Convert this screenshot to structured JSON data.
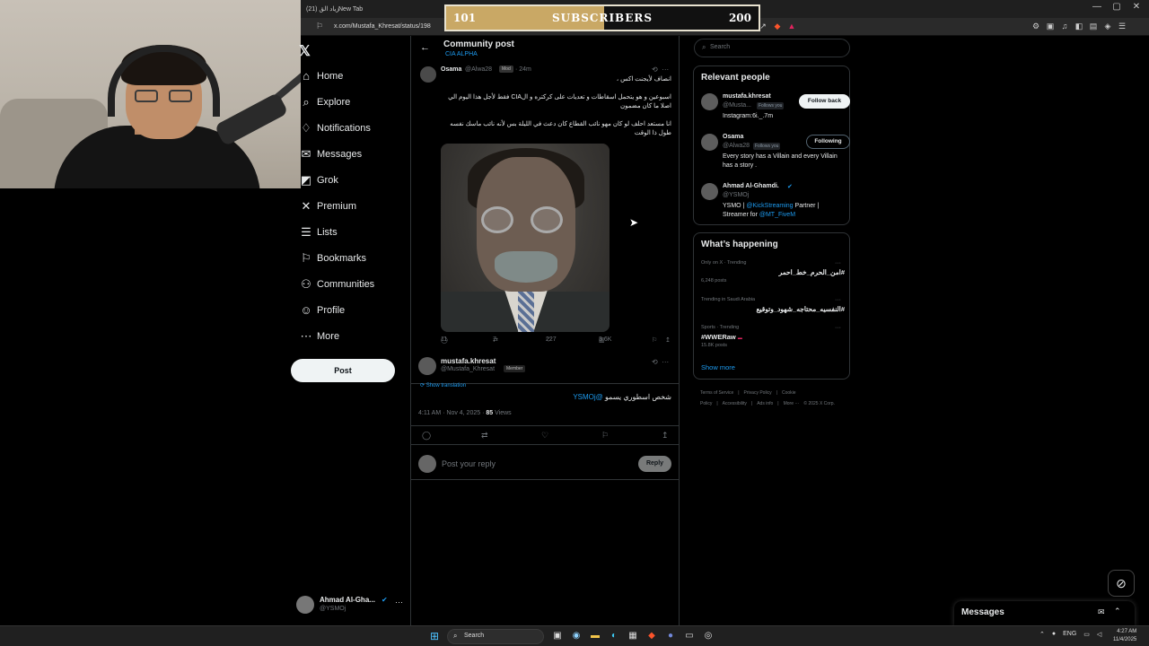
{
  "browser": {
    "tabs": [
      "(21) زياد الق",
      "New Tab"
    ],
    "url": "x.com/Mustafa_Khresat/status/198",
    "window_controls": [
      "—",
      "▢",
      "✕"
    ]
  },
  "subscriber_goal": {
    "current": "101",
    "label": "SUBSCRIBERS",
    "goal": "200",
    "progress_fraction": 0.505,
    "fill_color": "#c9a865"
  },
  "nav": {
    "logo": "𝕏",
    "items": [
      {
        "label": "Home",
        "icon": "home-icon",
        "glyph": "⌂"
      },
      {
        "label": "Explore",
        "icon": "search-icon",
        "glyph": "⌕"
      },
      {
        "label": "Notifications",
        "icon": "bell-icon",
        "glyph": "♢"
      },
      {
        "label": "Messages",
        "icon": "mail-icon",
        "glyph": "✉"
      },
      {
        "label": "Grok",
        "icon": "grok-icon",
        "glyph": "◩"
      },
      {
        "label": "Premium",
        "icon": "x-icon",
        "glyph": "✕"
      },
      {
        "label": "Lists",
        "icon": "list-icon",
        "glyph": "☰"
      },
      {
        "label": "Bookmarks",
        "icon": "bookmark-icon",
        "glyph": "⚐"
      },
      {
        "label": "Communities",
        "icon": "people-icon",
        "glyph": "⚇"
      },
      {
        "label": "Profile",
        "icon": "person-icon",
        "glyph": "☺"
      },
      {
        "label": "More",
        "icon": "more-circle-icon",
        "glyph": "⋯"
      }
    ],
    "post_button": "Post",
    "account": {
      "name": "Ahmad Al-Gha...",
      "handle": "@YSMOj"
    }
  },
  "main": {
    "title": "Community post",
    "community": "CIA ALPHA",
    "post1": {
      "name": "Osama",
      "handle": "@Alwa28",
      "badge": "Mod",
      "time": "· 24m",
      "lines": [
        "انصاف لأيجنت اكس ،",
        "اسبوعين و هو يتحمل اسقاطات و تعديات على كركتره و الCIA فقط لأجل هذا اليوم الي",
        "اصلا ما كان مضمون",
        "انا مستعد احلف لو كان مهو نائب القطاع كان دعث في الليلة بس لأنه نائب ماسك نفسه",
        "طول ذا الوقت"
      ],
      "replies": "11",
      "reposts": "7",
      "likes": "227",
      "views": "3.6K"
    },
    "post2": {
      "name": "mustafa.khresat",
      "handle": "@Mustafa_Khresat",
      "badge": "Member",
      "show_translation": "Show translation",
      "text": "شخص اسطوري يسمو",
      "mention": "@YSMOj",
      "timestamp": "4:11 AM · Nov 4, 2025 ·",
      "views_count": "85",
      "views_label": "Views"
    },
    "reply": {
      "placeholder": "Post your reply",
      "button": "Reply"
    }
  },
  "sidebar": {
    "search_placeholder": "Search",
    "relevant_title": "Relevant people",
    "people": [
      {
        "name": "mustafa.khresat",
        "handle": "@Musta...",
        "follows_you": "Follows you",
        "bio": "Instagram:6i._.7m",
        "button": "Follow back"
      },
      {
        "name": "Osama",
        "handle": "@Alwa28",
        "follows_you": "Follows you",
        "bio": "Every story has a Villain and every Villain has a story .",
        "button": "Following"
      },
      {
        "name": "Ahmad Al-Ghamdi.",
        "handle": "@YSMOj",
        "bio_pre": "YSMO |",
        "bio_link1": "@KickStreaming",
        "bio_mid": "Partner | Streamer for",
        "bio_link2": "@MT_FiveM"
      }
    ],
    "happening_title": "What’s happening",
    "trends": [
      {
        "context": "Only on X · Trending",
        "title": "#امن_الحرم_خط_احمر",
        "count": "6,248 posts"
      },
      {
        "context": "Trending in Saudi Arabia",
        "title": "#النفسيه_محتاجه_شهود_وتوقيع",
        "count": ""
      },
      {
        "context": "Sports · Trending",
        "title": "#WWERaw",
        "count": "15.8K posts"
      }
    ],
    "show_more": "Show more",
    "footer": [
      "Terms of Service",
      "|",
      "Privacy Policy",
      "|",
      "Cookie Policy",
      "|",
      "Accessibility",
      "|",
      "Ads info",
      "|",
      "More ···",
      "© 2025 X Corp."
    ]
  },
  "messages_drawer": {
    "title": "Messages"
  },
  "taskbar": {
    "search": "Search",
    "lang": "ENG",
    "time": "4:27 AM",
    "date": "11/4/2025"
  }
}
